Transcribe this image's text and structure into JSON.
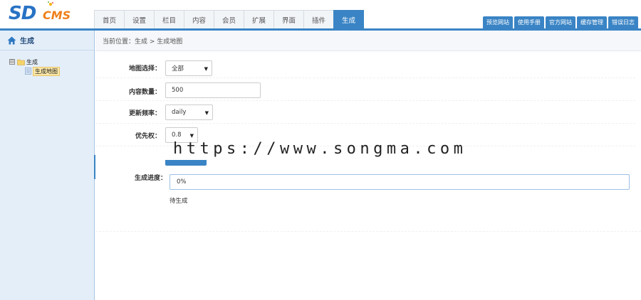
{
  "logo": {
    "primary": "SD",
    "secondary": "CMS"
  },
  "nav": {
    "items": [
      {
        "label": "首页",
        "active": false
      },
      {
        "label": "设置",
        "active": false
      },
      {
        "label": "栏目",
        "active": false
      },
      {
        "label": "内容",
        "active": false
      },
      {
        "label": "会员",
        "active": false
      },
      {
        "label": "扩展",
        "active": false
      },
      {
        "label": "界面",
        "active": false
      },
      {
        "label": "插件",
        "active": false
      },
      {
        "label": "生成",
        "active": true
      }
    ]
  },
  "toplinks": [
    "预览网站",
    "使用手册",
    "官方网站",
    "缓存管理",
    "错误日志"
  ],
  "sidebar": {
    "title": "生成",
    "tree": {
      "root": "生成",
      "toggle": "⊟",
      "child": "生成地图"
    }
  },
  "breadcrumb": "当前位置：生成 > 生成地图",
  "form": {
    "map_select": {
      "label": "地图选择：",
      "value": "全部"
    },
    "content_count": {
      "label": "内容数量：",
      "value": "500"
    },
    "update_freq": {
      "label": "更新频率：",
      "value": "daily"
    },
    "priority": {
      "label": "优先权：",
      "value": "0.8"
    },
    "progress": {
      "label": "生成进度：",
      "value": "0%",
      "status": "待生成"
    }
  },
  "watermark": "https://www.songma.com",
  "colors": {
    "accent": "#3a84c5",
    "logo_blue": "#2872c4",
    "logo_orange": "#ef7f1a",
    "sidebar_bg": "#e4eef9"
  }
}
